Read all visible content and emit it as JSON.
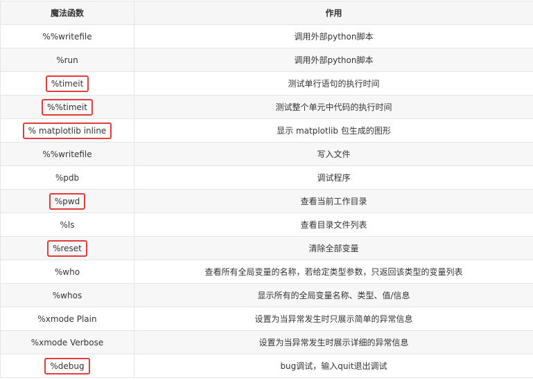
{
  "table": {
    "headers": [
      "魔法函数",
      "作用"
    ],
    "rows": [
      {
        "cmd": "%%writefile",
        "desc": "调用外部python脚本",
        "highlight": false
      },
      {
        "cmd": "%run",
        "desc": "调用外部python脚本",
        "highlight": false
      },
      {
        "cmd": "%timeit",
        "desc": "测试单行语句的执行时间",
        "highlight": true
      },
      {
        "cmd": "%%timeit",
        "desc": "测试整个单元中代码的执行时间",
        "highlight": true
      },
      {
        "cmd": "% matplotlib inline",
        "desc": "显示 matplotlib 包生成的图形",
        "highlight": true
      },
      {
        "cmd": "%%writefile",
        "desc": "写入文件",
        "highlight": false
      },
      {
        "cmd": "%pdb",
        "desc": "调试程序",
        "highlight": false
      },
      {
        "cmd": "%pwd",
        "desc": "查看当前工作目录",
        "highlight": true
      },
      {
        "cmd": "%ls",
        "desc": "查看目录文件列表",
        "highlight": false
      },
      {
        "cmd": "%reset",
        "desc": "清除全部变量",
        "highlight": true
      },
      {
        "cmd": "%who",
        "desc": "查看所有全局变量的名称，若给定类型参数，只返回该类型的变量列表",
        "highlight": false
      },
      {
        "cmd": "%whos",
        "desc": "显示所有的全局变量名称、类型、值/信息",
        "highlight": false
      },
      {
        "cmd": "%xmode Plain",
        "desc": "设置为当异常发生时只展示简单的异常信息",
        "highlight": false
      },
      {
        "cmd": "%xmode Verbose",
        "desc": "设置为当异常发生时展示详细的异常信息",
        "highlight": false
      },
      {
        "cmd": "%debug",
        "desc": "bug调试，输入quit退出调试",
        "highlight": true
      }
    ]
  },
  "colors": {
    "highlight_border": "#e53a3a",
    "header_bg": "#f6f6f6",
    "stripe_bg": "#f7f7f7",
    "border": "#e4e4e4"
  }
}
